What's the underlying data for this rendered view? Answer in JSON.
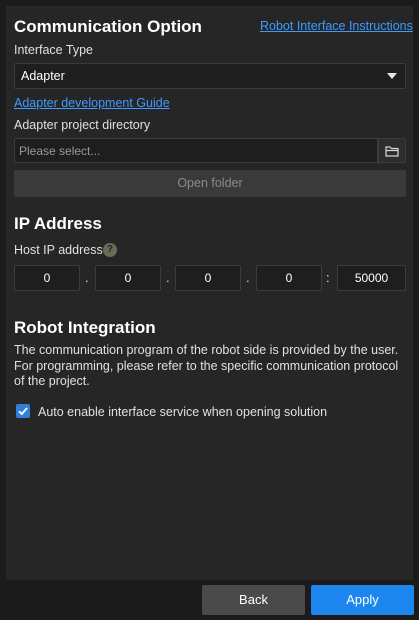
{
  "communication": {
    "title": "Communication Option",
    "instructions_link": "Robot Interface Instructions",
    "interface_type_label": "Interface Type",
    "interface_type_value": "Adapter",
    "dev_guide_link": "Adapter development Guide",
    "project_dir_label": "Adapter project directory",
    "project_dir_placeholder": "Please select...",
    "open_folder_label": "Open folder"
  },
  "ip": {
    "title": "IP Address",
    "host_label": "Host IP address",
    "help_glyph": "?",
    "octets": [
      "0",
      "0",
      "0",
      "0"
    ],
    "dot": ".",
    "colon": ":",
    "port": "50000"
  },
  "robot": {
    "title": "Robot Integration",
    "description": "The communication program of the robot side is provided by the user. For programming, please refer to the specific communication protocol of the project.",
    "auto_enable_label": "Auto enable interface service when opening solution",
    "auto_enable_checked": true
  },
  "footer": {
    "back_label": "Back",
    "apply_label": "Apply"
  },
  "icons": {
    "folder": "folder-icon",
    "caret": "chevron-down-icon",
    "check": "checkmark-icon"
  },
  "colors": {
    "accent": "#1c86ee",
    "link": "#3d9bff",
    "panel": "#262626"
  }
}
